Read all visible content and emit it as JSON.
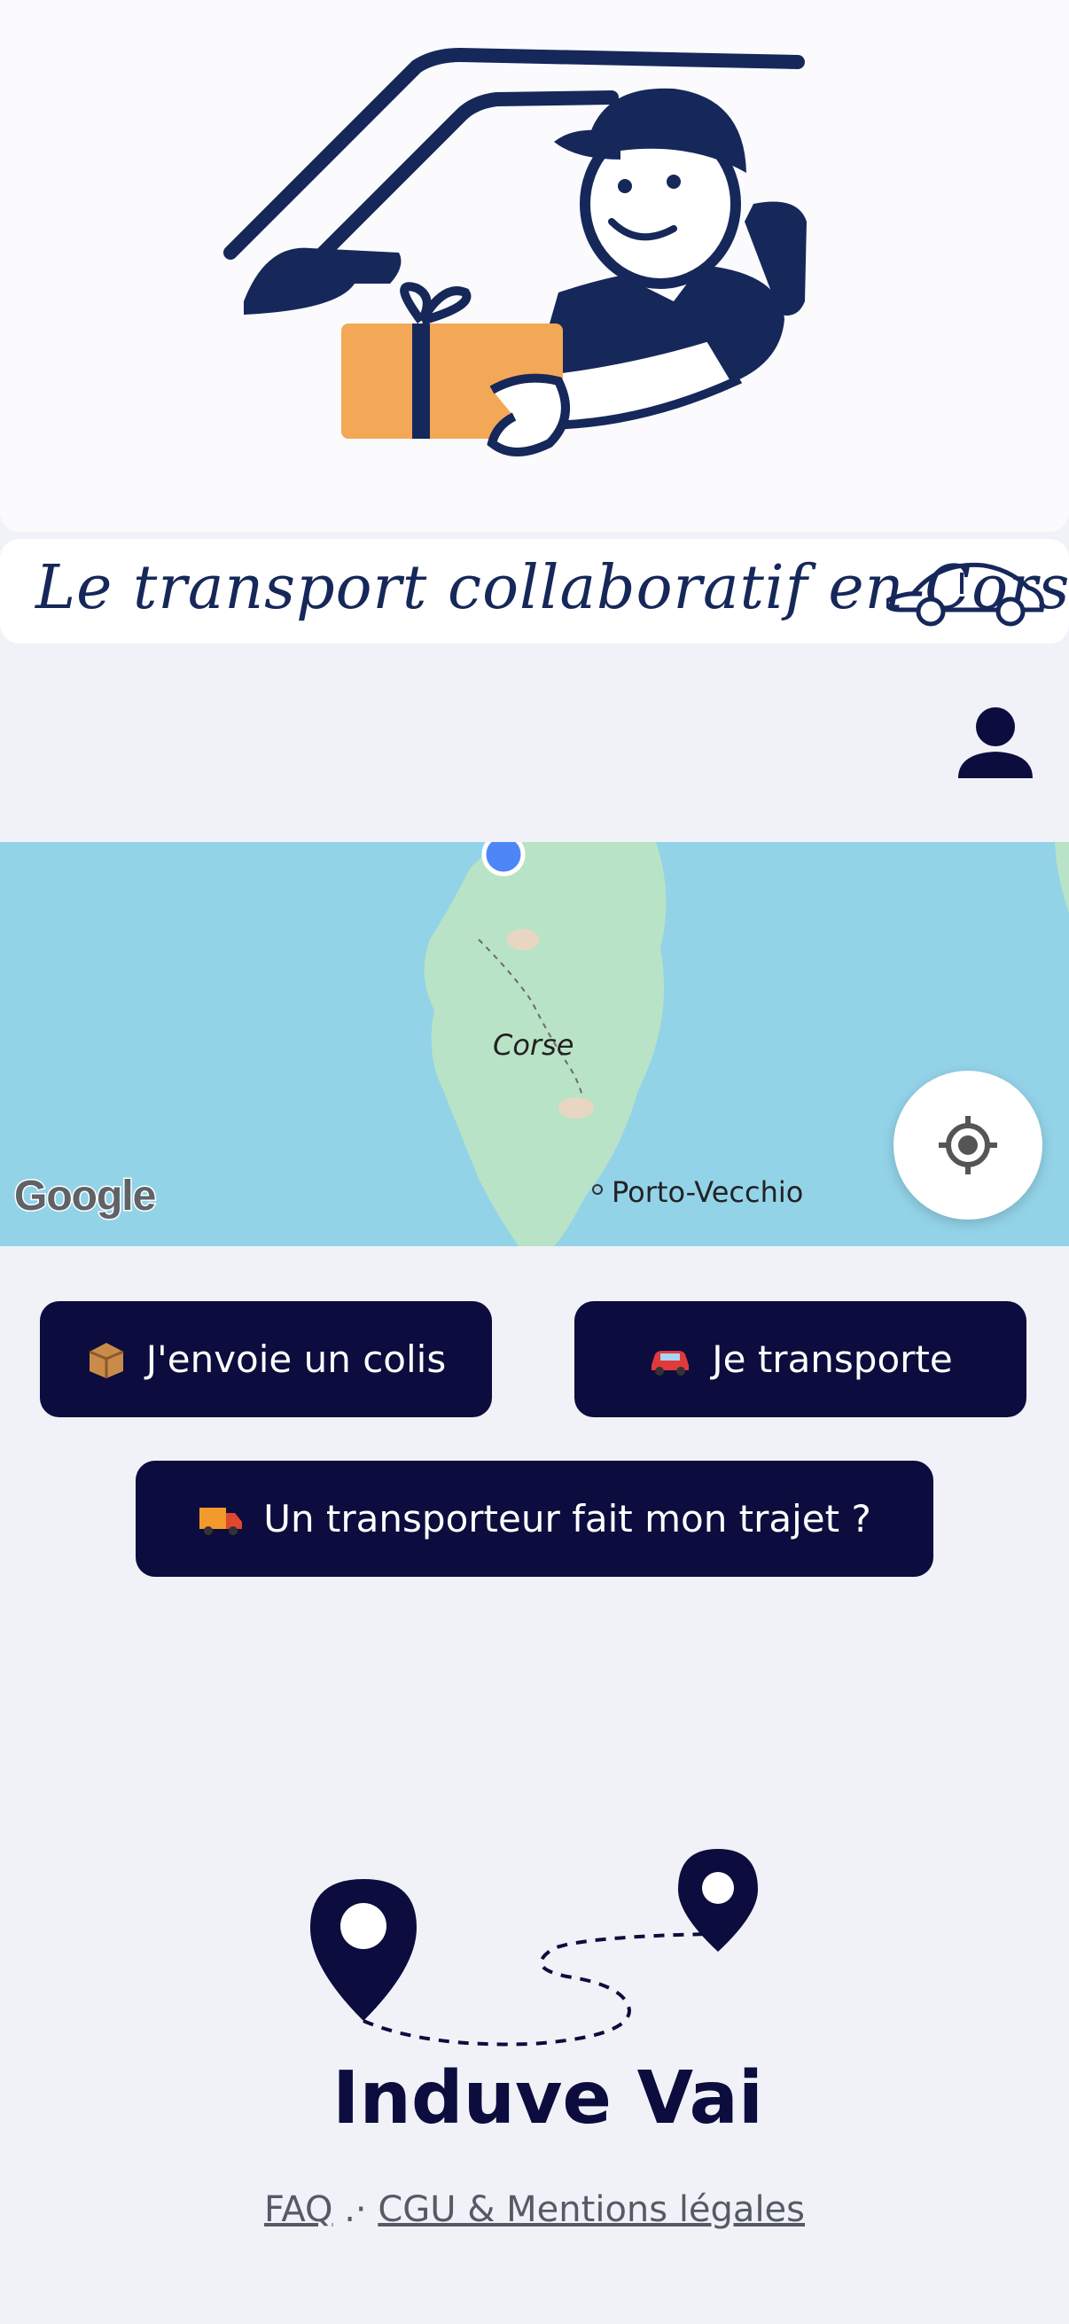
{
  "hero": {
    "tagline": "Le transport collaboratif en Corse",
    "colors": {
      "navy": "#16285a",
      "package": "#f3a857"
    }
  },
  "header": {
    "profile_icon": "user-icon"
  },
  "map": {
    "labels": {
      "region": "Corse",
      "town": "Porto-Vecchio"
    },
    "provider": "Google",
    "locate_icon": "crosshair-icon"
  },
  "actions": {
    "send_label": "J'envoie un colis",
    "send_icon": "package-icon",
    "carry_label": "Je transporte",
    "carry_icon": "car-icon",
    "route_label": "Un transporteur fait mon trajet ?",
    "route_icon": "truck-icon"
  },
  "brand": {
    "name": "Induve Vai"
  },
  "footer": {
    "faq": "FAQ",
    "separator": ".·",
    "legal": "CGU & Mentions légales"
  },
  "colors": {
    "button_bg": "#0c0c3e",
    "page_bg": "#f1f2f7",
    "sea": "#93d3e8",
    "land": "#b9e3c6"
  }
}
